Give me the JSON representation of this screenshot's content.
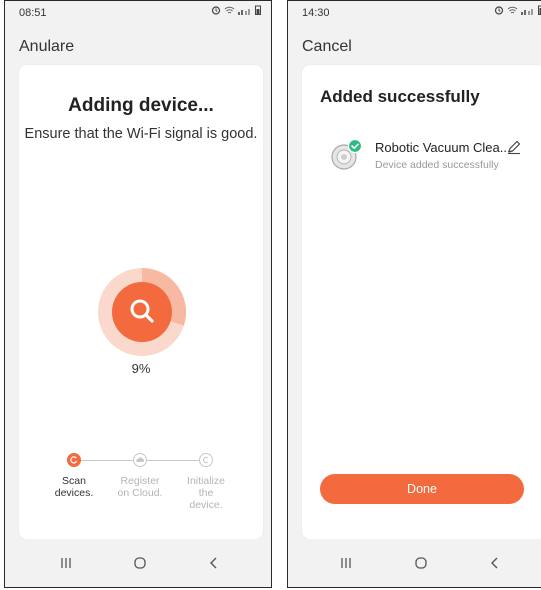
{
  "left": {
    "status_time": "08:51",
    "cancel_label": "Anulare",
    "title": "Adding device...",
    "subtitle": "Ensure that the Wi-Fi signal is good.",
    "progress": 0.09,
    "progress_text": "9%",
    "steps": [
      {
        "label": "Scan devices.",
        "state": "active"
      },
      {
        "label": "Register on Cloud.",
        "state": "pending"
      },
      {
        "label": "Initialize the device.",
        "state": "pending"
      }
    ]
  },
  "right": {
    "status_time": "14:30",
    "cancel_label": "Cancel",
    "title": "Added successfully",
    "device_name": "Robotic Vacuum Clea...",
    "device_status": "Device added successfully",
    "done_label": "Done"
  },
  "icons": {
    "search": "search-icon",
    "edit": "pencil-icon",
    "check": "check-badge-icon",
    "nav_recent": "recent-apps-icon",
    "nav_home": "home-icon",
    "nav_back": "back-icon"
  },
  "colors": {
    "accent": "#f26a3d",
    "accent_light": "#f8b9a3",
    "accent_pale": "#fbd8cc",
    "success": "#2dbb84",
    "inactive": "#c8c8c8",
    "background": "#f2f2f2",
    "card": "#ffffff"
  }
}
